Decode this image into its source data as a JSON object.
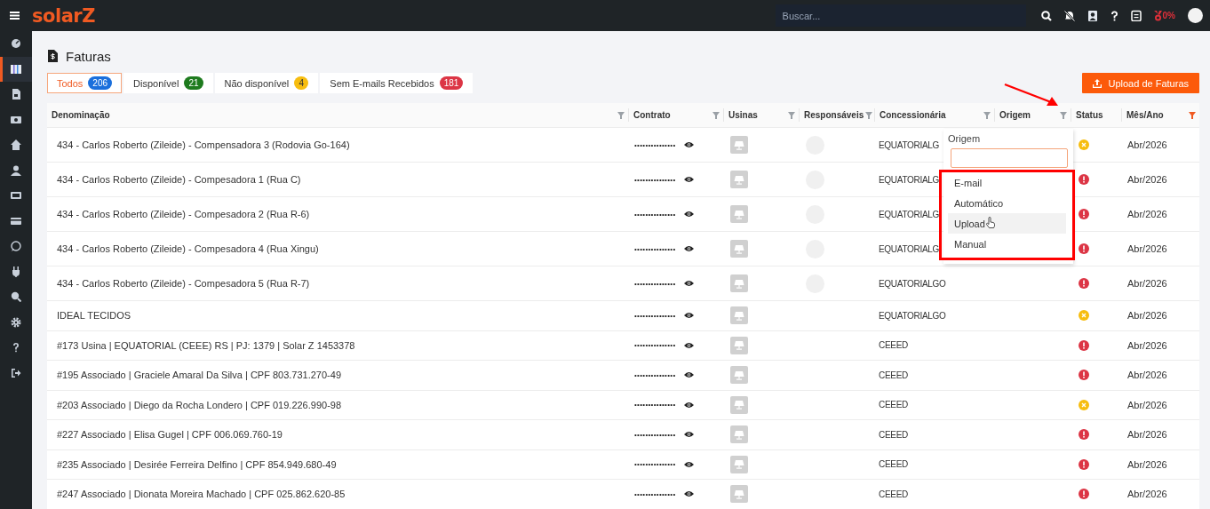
{
  "topbar": {
    "logo": "solarZ",
    "search": {
      "placeholder": "Buscar..."
    },
    "progress_label": "0%"
  },
  "sidebar": {
    "items": [
      {
        "selected": false
      },
      {
        "selected": true
      },
      {
        "selected": false
      },
      {
        "selected": false
      },
      {
        "selected": false
      },
      {
        "selected": false
      },
      {
        "selected": false
      },
      {
        "selected": false
      },
      {
        "selected": false
      },
      {
        "selected": false
      },
      {
        "selected": false
      },
      {
        "selected": false
      },
      {
        "selected": false
      },
      {
        "selected": false
      }
    ]
  },
  "page": {
    "title": "Faturas",
    "upload_button": "Upload de Faturas"
  },
  "tabs": [
    {
      "label": "Todos",
      "count": "206",
      "color": "#1a6fdc",
      "selected": true
    },
    {
      "label": "Disponível",
      "count": "21",
      "color": "#1e7b1e",
      "selected": false
    },
    {
      "label": "Não disponível",
      "count": "4",
      "color": "#f7bd0f",
      "selected": false
    },
    {
      "label": "Sem E-mails Recebidos",
      "count": "181",
      "color": "#dc3545",
      "selected": false
    }
  ],
  "table": {
    "columns": [
      {
        "label": "Denominação",
        "filterable": true,
        "filter_active": false
      },
      {
        "label": "Contrato",
        "filterable": true,
        "filter_active": false
      },
      {
        "label": "Usinas",
        "filterable": true,
        "filter_active": false
      },
      {
        "label": "Responsáveis",
        "filterable": true,
        "filter_active": false
      },
      {
        "label": "Concessionária",
        "filterable": true,
        "filter_active": false
      },
      {
        "label": "Origem",
        "filterable": true,
        "filter_active": false
      },
      {
        "label": "Status",
        "filterable": false
      },
      {
        "label": "Mês/Ano",
        "filterable": true,
        "filter_active": true
      }
    ],
    "rows": [
      {
        "name": "434 - Carlos Roberto (Zileide) - Compensadora 3 (Rodovia Go-164)",
        "contract": "•••••••••••••••",
        "responsible": true,
        "utility": "EQUATORIALG",
        "error": false,
        "month": "Abr/2026"
      },
      {
        "name": "434 - Carlos Roberto (Zileide) - Compesadora 1 (Rua C)",
        "contract": "•••••••••••••••",
        "responsible": true,
        "utility": "EQUATORIALG",
        "error": true,
        "month": "Abr/2026"
      },
      {
        "name": "434 - Carlos Roberto (Zileide) - Compesadora 2 (Rua R-6)",
        "contract": "•••••••••••••••",
        "responsible": true,
        "utility": "EQUATORIALG",
        "error": true,
        "month": "Abr/2026"
      },
      {
        "name": "434 - Carlos Roberto (Zileide) - Compesadora 4 (Rua Xingu)",
        "contract": "•••••••••••••••",
        "responsible": true,
        "utility": "EQUATORIALG",
        "error": true,
        "month": "Abr/2026"
      },
      {
        "name": "434 - Carlos Roberto (Zileide) - Compesadora 5 (Rua R-7)",
        "contract": "•••••••••••••••",
        "responsible": true,
        "utility": "EQUATORIALGO",
        "error": true,
        "month": "Abr/2026"
      },
      {
        "name": "IDEAL TECIDOS",
        "contract": "•••••••••••••••",
        "responsible": false,
        "utility": "EQUATORIALGO",
        "error": false,
        "month": "Abr/2026"
      },
      {
        "name": "#173 Usina | EQUATORIAL (CEEE) RS | PJ: 1379 | Solar Z 1453378",
        "contract": "•••••••••••••••",
        "responsible": false,
        "utility": "CEEED",
        "error": true,
        "month": "Abr/2026"
      },
      {
        "name": "#195 Associado | Graciele Amaral Da Silva | CPF 803.731.270-49",
        "contract": "•••••••••••••••",
        "responsible": false,
        "utility": "CEEED",
        "error": true,
        "month": "Abr/2026"
      },
      {
        "name": "#203 Associado | Diego da Rocha Londero | CPF 019.226.990-98",
        "contract": "•••••••••••••••",
        "responsible": false,
        "utility": "CEEED",
        "error": false,
        "month": "Abr/2026"
      },
      {
        "name": "#227 Associado | Elisa Gugel | CPF 006.069.760-19",
        "contract": "•••••••••••••••",
        "responsible": false,
        "utility": "CEEED",
        "error": true,
        "month": "Abr/2026"
      },
      {
        "name": "#235 Associado | Desirée Ferreira Delfino | CPF 854.949.680-49",
        "contract": "•••••••••••••••",
        "responsible": false,
        "utility": "CEEED",
        "error": true,
        "month": "Abr/2026"
      },
      {
        "name": "#247 Associado | Dionata Moreira Machado | CPF 025.862.620-85",
        "contract": "•••••••••••••••",
        "responsible": false,
        "utility": "CEEED",
        "error": true,
        "month": "Abr/2026"
      }
    ]
  },
  "filter_dropdown": {
    "title": "Origem",
    "options": [
      {
        "label": "E-mail",
        "highlighted": false
      },
      {
        "label": "Automático",
        "highlighted": false
      },
      {
        "label": "Upload",
        "highlighted": true
      },
      {
        "label": "Manual",
        "highlighted": false
      }
    ]
  }
}
